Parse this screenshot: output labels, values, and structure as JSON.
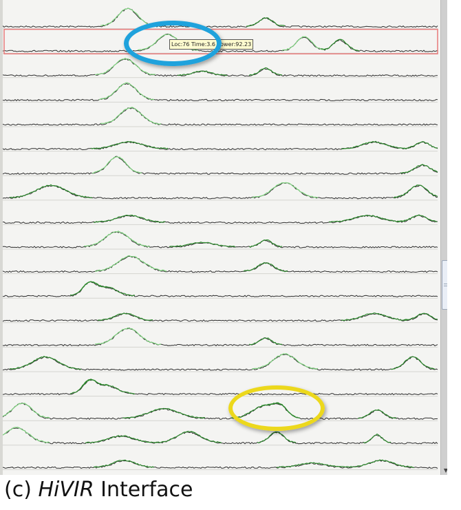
{
  "viewer": {
    "tooltip_text": "Loc:76 Time:3.6 Power:92.23",
    "track_count": 19,
    "selected_track": 1,
    "colors": {
      "baseline": "#2c2c2c",
      "peak_dark": "#2e8b2e",
      "peak_light": "#7fd47f",
      "selection": "#e87a7a",
      "marker_blue": "#1fa2dc",
      "marker_yellow": "#ecd81c"
    }
  },
  "caption": {
    "prefix": "(c) ",
    "emphasis": "HiVIR",
    "suffix": " Interface"
  }
}
